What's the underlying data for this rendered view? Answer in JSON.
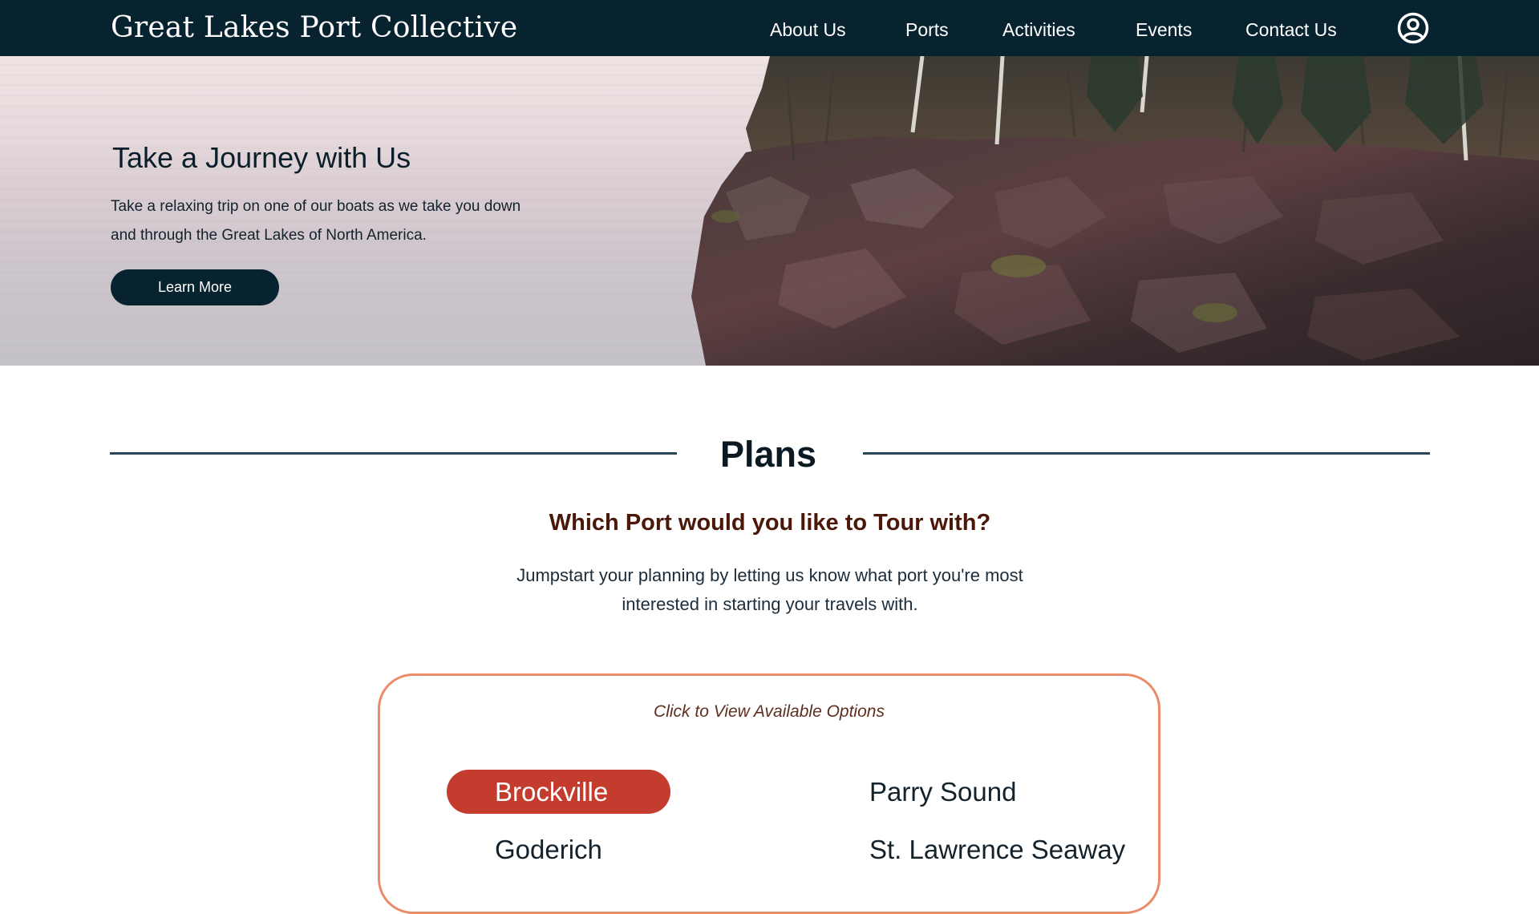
{
  "header": {
    "brand": "Great Lakes Port Collective",
    "nav": [
      {
        "label": "About Us"
      },
      {
        "label": "Ports"
      },
      {
        "label": "Activities"
      },
      {
        "label": "Events"
      },
      {
        "label": "Contact Us"
      }
    ],
    "account_icon": "user-circle-icon"
  },
  "hero": {
    "title": "Take a Journey with Us",
    "text": "Take a relaxing trip on one of our boats as we take you down and through the Great Lakes of North America.",
    "button_label": "Learn More"
  },
  "plans": {
    "title": "Plans",
    "subtitle": "Which Port would you like to Tour with?",
    "description": "Jumpstart your planning by letting us know what port you're most interested in starting your travels with.",
    "options_hint": "Click to View Available Options",
    "ports": [
      {
        "label": "Brockville",
        "selected": true
      },
      {
        "label": "Parry Sound",
        "selected": false
      },
      {
        "label": "Goderich",
        "selected": false
      },
      {
        "label": "St. Lawrence Seaway",
        "selected": false
      }
    ]
  },
  "colors": {
    "header_bg": "#082330",
    "accent_selected": "#c43c2e",
    "card_border": "#ea8c6a",
    "subtitle": "#4a1709"
  }
}
